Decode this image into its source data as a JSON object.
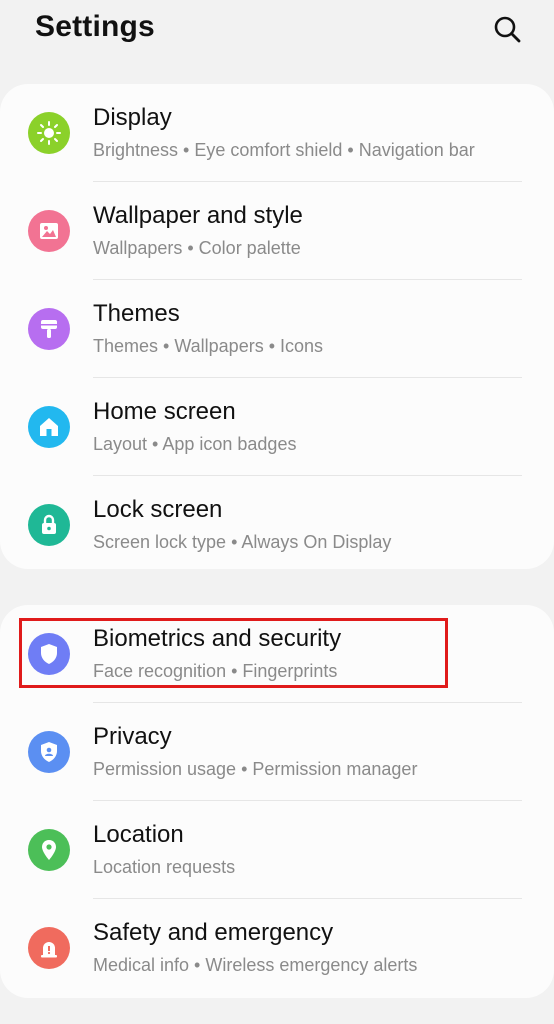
{
  "header": {
    "title": "Settings",
    "search_icon": "search-icon"
  },
  "groups": [
    {
      "items": [
        {
          "label": "Display",
          "subtitle": "Brightness  •  Eye comfort shield  •  Navigation bar",
          "icon": "sun-icon",
          "color": "#8bd12a"
        },
        {
          "label": "Wallpaper and style",
          "subtitle": "Wallpapers  •  Color palette",
          "icon": "image-icon",
          "color": "#f27393"
        },
        {
          "label": "Themes",
          "subtitle": "Themes  •  Wallpapers  •  Icons",
          "icon": "paint-brush-icon",
          "color": "#b76ef0"
        },
        {
          "label": "Home screen",
          "subtitle": "Layout  •  App icon badges",
          "icon": "home-icon",
          "color": "#22b8ef"
        },
        {
          "label": "Lock screen",
          "subtitle": "Screen lock type  •  Always On Display",
          "icon": "lock-icon",
          "color": "#1fb896"
        }
      ]
    },
    {
      "items": [
        {
          "label": "Biometrics and security",
          "subtitle": "Face recognition  •  Fingerprints",
          "icon": "shield-icon",
          "color": "#6f7df5"
        },
        {
          "label": "Privacy",
          "subtitle": "Permission usage  •  Permission manager",
          "icon": "privacy-shield-icon",
          "color": "#5b8ff2"
        },
        {
          "label": "Location",
          "subtitle": "Location requests",
          "icon": "location-pin-icon",
          "color": "#4cbf58"
        },
        {
          "label": "Safety and emergency",
          "subtitle": "Medical info  •  Wireless emergency alerts",
          "icon": "alert-icon",
          "color": "#f06b5e"
        }
      ]
    }
  ],
  "highlight_color": "#e01b1b"
}
